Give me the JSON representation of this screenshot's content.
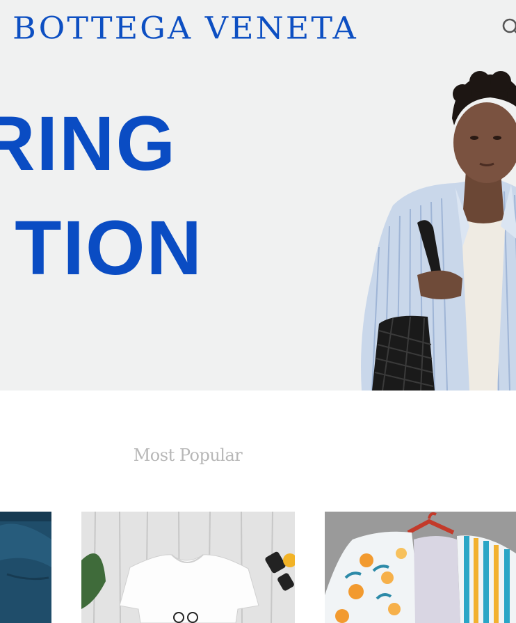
{
  "header": {
    "brand": "BOTTEGA VENETA",
    "search_icon": "search-icon"
  },
  "hero": {
    "line1": "RING",
    "line2": "TION",
    "image_description_icon": "model-photo"
  },
  "popular": {
    "title": "Most Popular",
    "products": [
      {
        "image": "denim-shirt-photo"
      },
      {
        "image": "white-tshirt-photo"
      },
      {
        "image": "floral-shirt-photo"
      }
    ]
  },
  "colors": {
    "brand_blue": "#0d4fc2",
    "hero_bg": "#f0f1f1",
    "section_title": "#b7b7b7"
  }
}
